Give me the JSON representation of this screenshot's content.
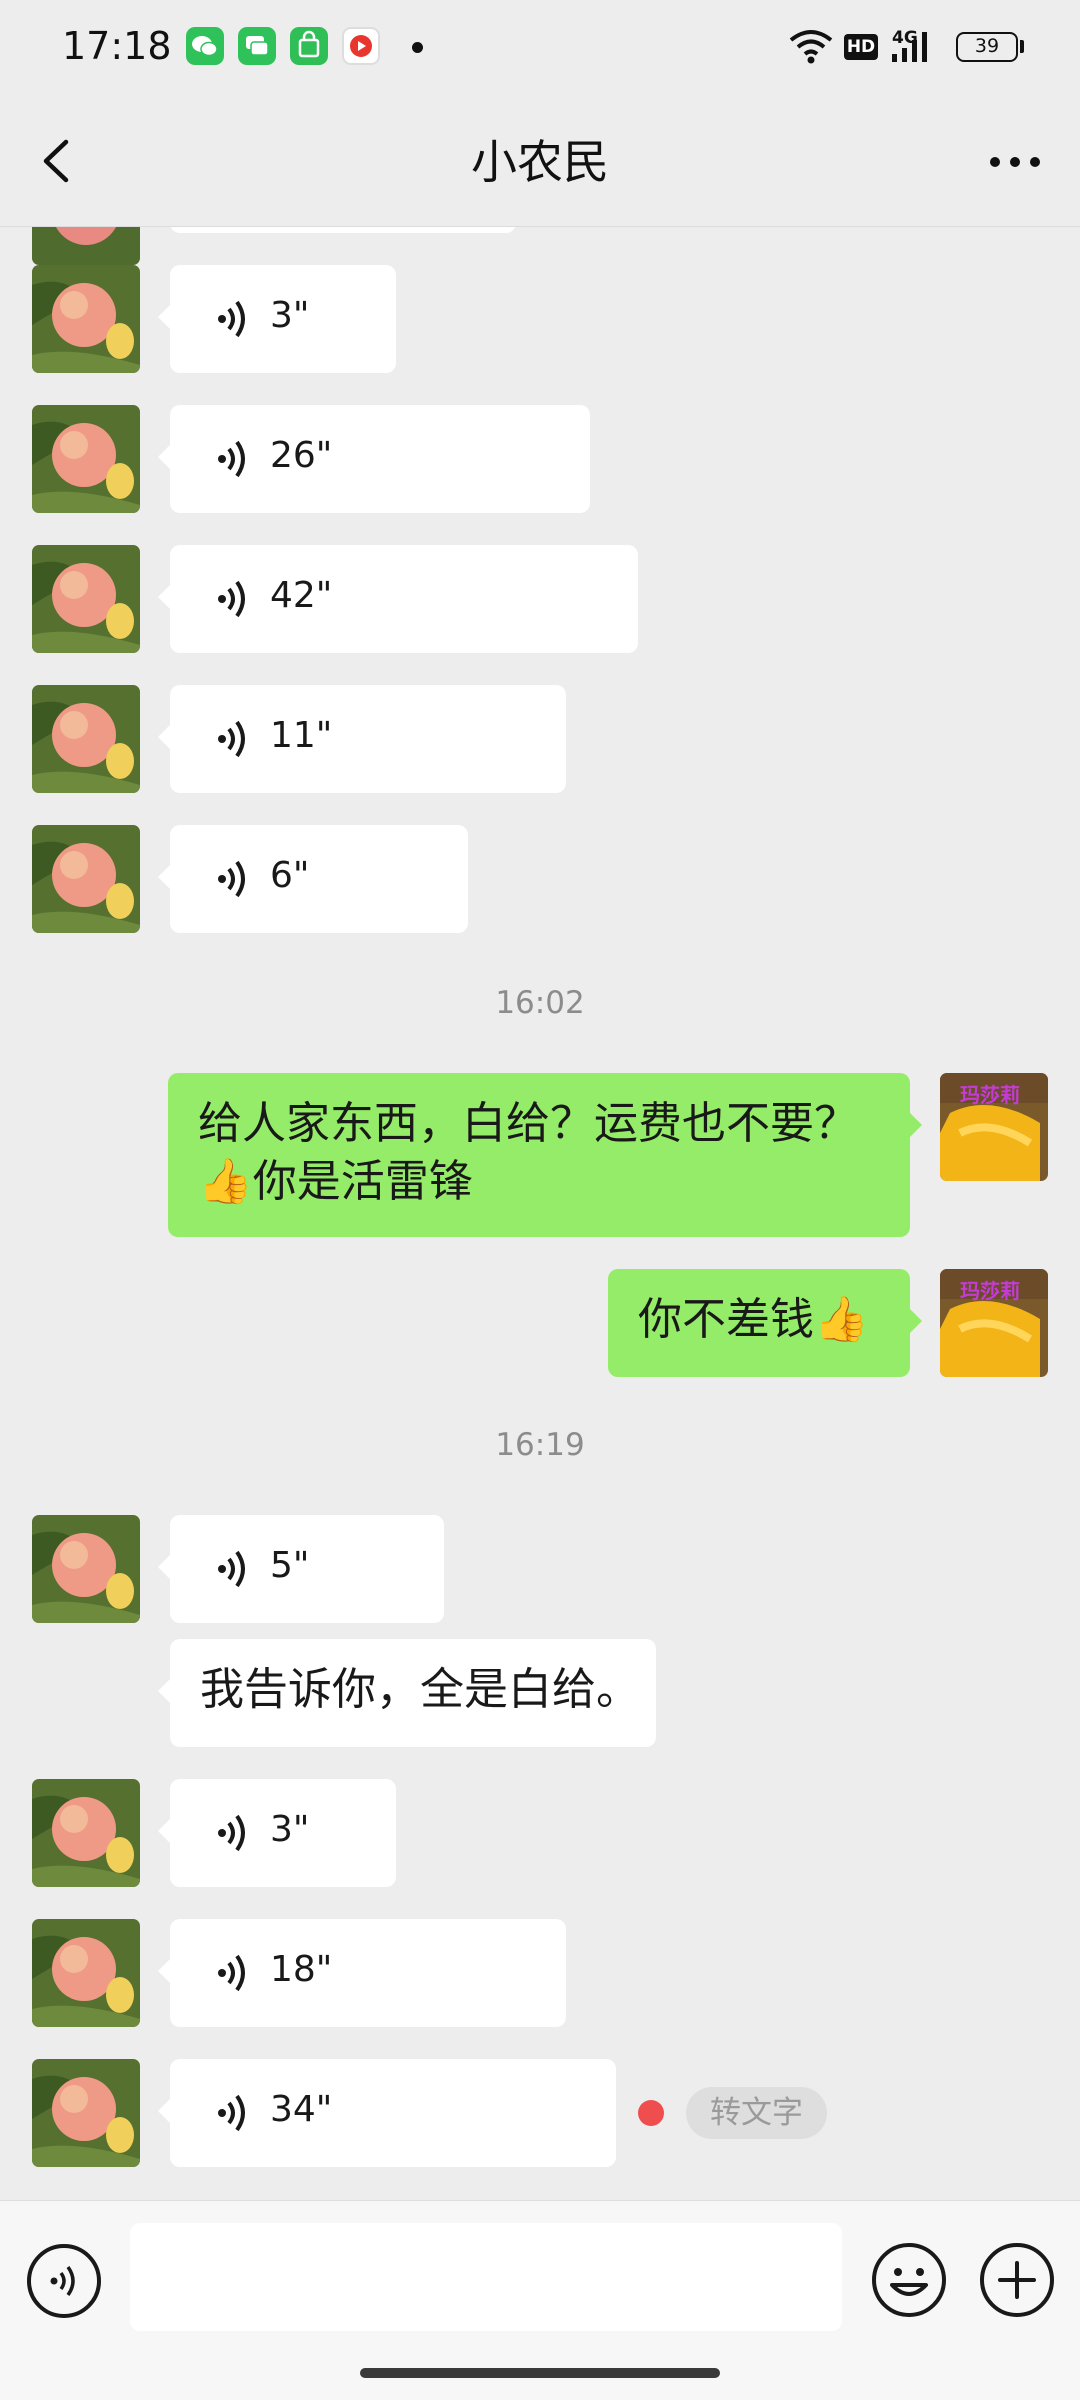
{
  "status_bar": {
    "time": "17:18",
    "network": "4G",
    "hd_badge": "HD",
    "battery": "39",
    "notification_icons": [
      "wechat-icon",
      "messages-icon",
      "store-icon",
      "video-icon"
    ]
  },
  "header": {
    "title": "小农民",
    "back_icon": "chevron-left-icon",
    "more_icon": "more-horizontal-icon"
  },
  "messages": [
    {
      "type": "voice",
      "side": "left",
      "duration": "3\""
    },
    {
      "type": "voice",
      "side": "left",
      "duration": "26\""
    },
    {
      "type": "voice",
      "side": "left",
      "duration": "42\""
    },
    {
      "type": "voice",
      "side": "left",
      "duration": "11\""
    },
    {
      "type": "voice",
      "side": "left",
      "duration": "6\""
    },
    {
      "type": "timestamp",
      "text": "16:02"
    },
    {
      "type": "text",
      "side": "right",
      "line1": "给人家东西，白给？运费也不要？",
      "line2": "👍你是活雷锋"
    },
    {
      "type": "text",
      "side": "right",
      "text": "你不差钱👍"
    },
    {
      "type": "timestamp",
      "text": "16:19"
    },
    {
      "type": "voice",
      "side": "left",
      "duration": "5\""
    },
    {
      "type": "text",
      "side": "left",
      "text": "我告诉你，全是白给。"
    },
    {
      "type": "voice",
      "side": "left",
      "duration": "3\""
    },
    {
      "type": "voice",
      "side": "left",
      "duration": "18\""
    },
    {
      "type": "voice",
      "side": "left",
      "duration": "34\"",
      "unread": true,
      "action_label": "转文字"
    }
  ],
  "right_avatar_caption": "玛莎莉",
  "input_bar": {
    "placeholder": "",
    "voice_icon": "voice-toggle-icon",
    "emoji_icon": "emoji-icon",
    "plus_icon": "plus-icon"
  },
  "colors": {
    "background": "#ededed",
    "own_bubble": "#95ec69",
    "other_bubble": "#ffffff",
    "unread_dot": "#f04e4e"
  }
}
